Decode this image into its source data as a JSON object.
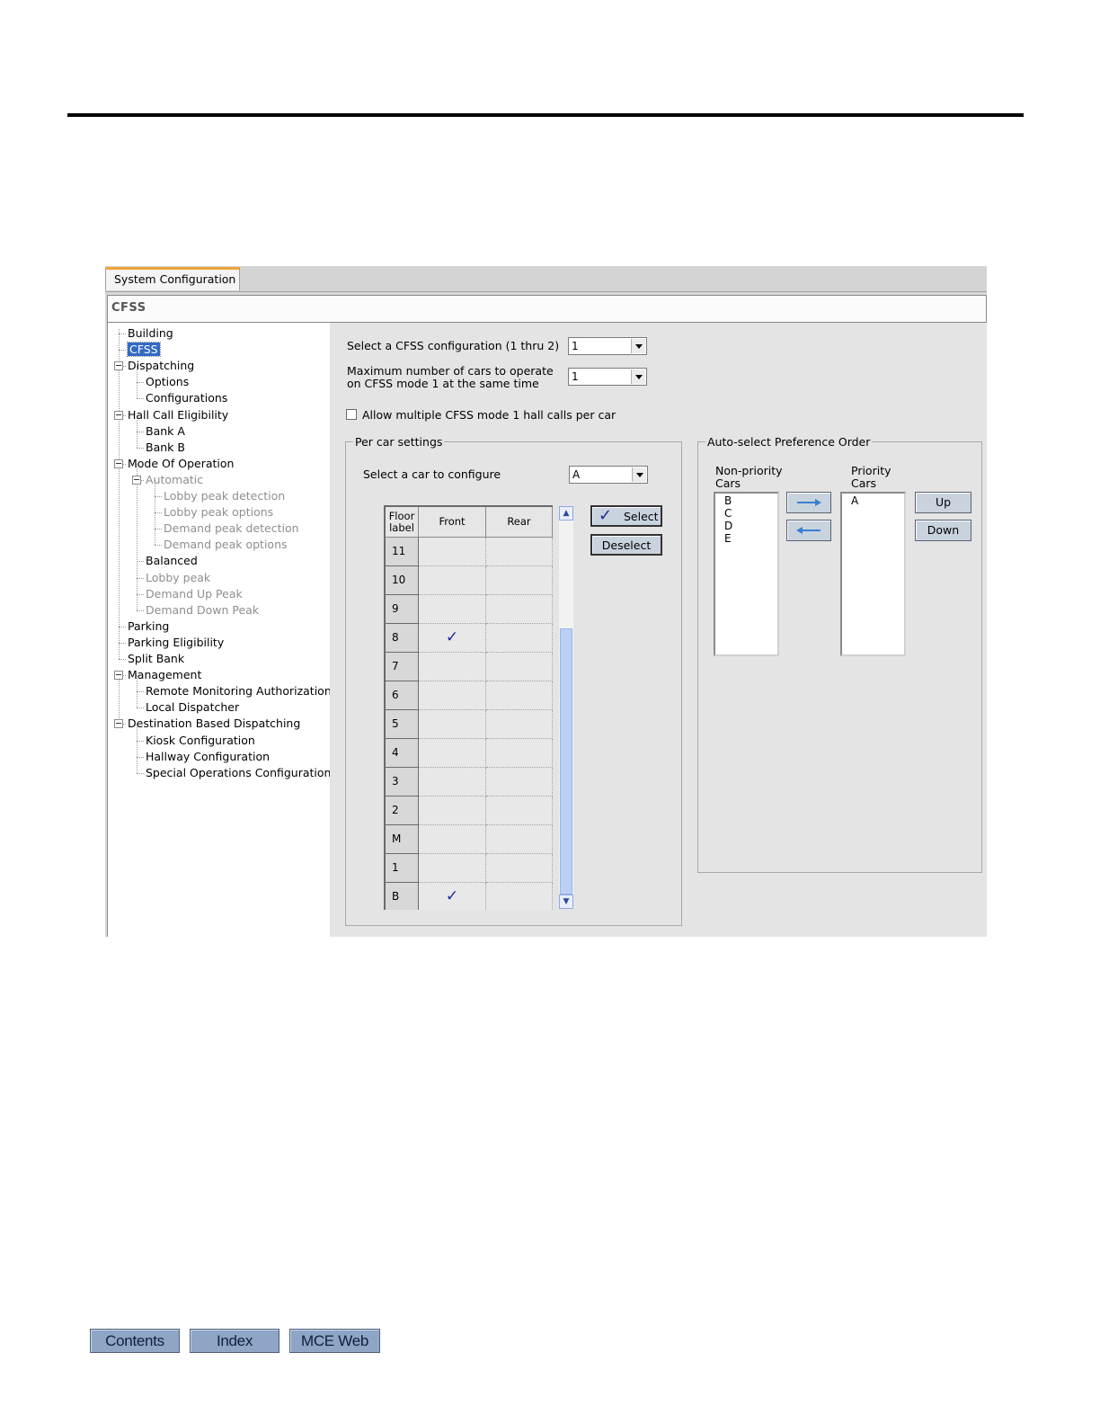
{
  "tab": "System Configuration",
  "section_title": "CFSS",
  "tree": [
    {
      "label": "Building",
      "state": "normal"
    },
    {
      "label": "CFSS",
      "state": "selected"
    },
    {
      "label": "Dispatching",
      "state": "expanded"
    },
    {
      "label": "Options",
      "state": "normal"
    },
    {
      "label": "Configurations",
      "state": "normal"
    },
    {
      "label": "Hall Call Eligibility",
      "state": "expanded"
    },
    {
      "label": "Bank A",
      "state": "normal"
    },
    {
      "label": "Bank B",
      "state": "normal"
    },
    {
      "label": "Mode Of Operation",
      "state": "expanded"
    },
    {
      "label": "Automatic",
      "state": "disabled"
    },
    {
      "label": "Lobby peak detection",
      "state": "disabled"
    },
    {
      "label": "Lobby peak options",
      "state": "disabled"
    },
    {
      "label": "Demand peak detection",
      "state": "disabled"
    },
    {
      "label": "Demand peak options",
      "state": "disabled"
    },
    {
      "label": "Balanced",
      "state": "normal"
    },
    {
      "label": "Lobby peak",
      "state": "disabled"
    },
    {
      "label": "Demand Up Peak",
      "state": "disabled"
    },
    {
      "label": "Demand Down Peak",
      "state": "disabled"
    },
    {
      "label": "Parking",
      "state": "normal"
    },
    {
      "label": "Parking Eligibility",
      "state": "normal"
    },
    {
      "label": "Split Bank",
      "state": "normal"
    },
    {
      "label": "Management",
      "state": "expanded"
    },
    {
      "label": "Remote Monitoring Authorization",
      "state": "normal"
    },
    {
      "label": "Local Dispatcher",
      "state": "normal"
    },
    {
      "label": "Destination Based Dispatching",
      "state": "expanded"
    },
    {
      "label": "Kiosk Configuration",
      "state": "normal"
    },
    {
      "label": "Hallway Configuration",
      "state": "normal"
    },
    {
      "label": "Special Operations Configuration",
      "state": "normal"
    }
  ],
  "config_select": {
    "label": "Select a CFSS configuration (1 thru 2)",
    "value": "1"
  },
  "max_cars": {
    "label_line1": "Maximum number of cars to operate",
    "label_line2": "on CFSS mode 1 at the same time",
    "value": "1"
  },
  "allow_multiple": {
    "label": "Allow multiple CFSS mode 1 hall calls per car",
    "checked": false
  },
  "per_car": {
    "legend": "Per car settings",
    "car_label": "Select a car to configure",
    "car_value": "A",
    "col_floor_line1": "Floor",
    "col_floor_line2": "label",
    "col_front": "Front",
    "col_rear": "Rear",
    "check_glyph": "✓",
    "rows": [
      {
        "floor": "11",
        "front": false,
        "rear": false
      },
      {
        "floor": "10",
        "front": false,
        "rear": false
      },
      {
        "floor": "9",
        "front": false,
        "rear": false
      },
      {
        "floor": "8",
        "front": true,
        "rear": false
      },
      {
        "floor": "7",
        "front": false,
        "rear": false
      },
      {
        "floor": "6",
        "front": false,
        "rear": false
      },
      {
        "floor": "5",
        "front": false,
        "rear": false
      },
      {
        "floor": "4",
        "front": false,
        "rear": false
      },
      {
        "floor": "3",
        "front": false,
        "rear": false
      },
      {
        "floor": "2",
        "front": false,
        "rear": false
      },
      {
        "floor": "M",
        "front": false,
        "rear": false
      },
      {
        "floor": "1",
        "front": false,
        "rear": false
      },
      {
        "floor": "B",
        "front": true,
        "rear": false
      }
    ],
    "select_label": "Select",
    "deselect_label": "Deselect"
  },
  "auto_select": {
    "legend": "Auto-select Preference Order",
    "nonpriority_line1": "Non-priority",
    "nonpriority_line2": "Cars",
    "priority_line1": "Priority",
    "priority_line2": "Cars",
    "nonpriority_cars": [
      "B",
      "C",
      "D",
      "E"
    ],
    "priority_cars": [
      "A"
    ],
    "up_label": "Up",
    "down_label": "Down"
  },
  "footer": {
    "contents": "Contents",
    "index": "Index",
    "mce_web": "MCE Web"
  },
  "colors": {
    "selection": "#316ac5",
    "tab_accent": "#f0a43a",
    "arrow": "#3a7fd0",
    "check": "#1a2a9a",
    "nav_button": "#8ea5c6"
  }
}
